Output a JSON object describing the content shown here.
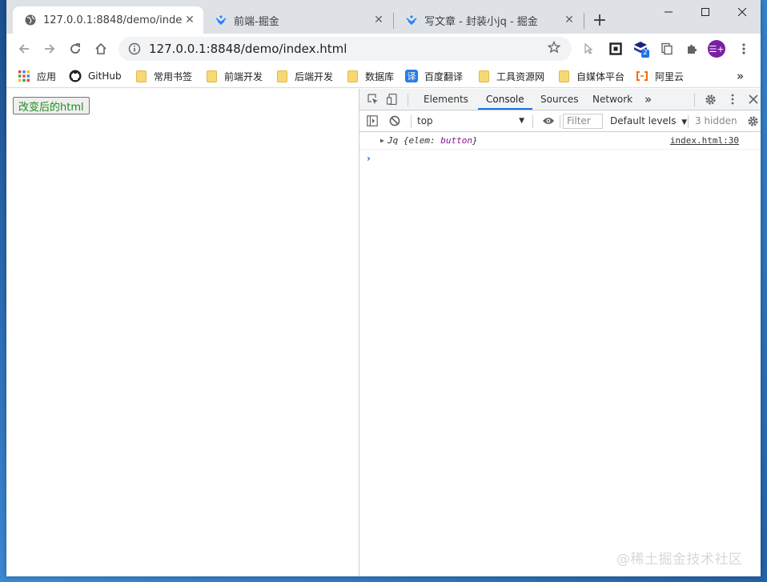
{
  "browser": {
    "tabs": [
      {
        "title": "127.0.0.1:8848/demo/index.html",
        "active": true,
        "favicon": "globe-icon"
      },
      {
        "title": "前端-掘金",
        "active": false,
        "favicon": "juejin-logo-icon"
      },
      {
        "title": "写文章 - 封装小jq - 掘金",
        "active": false,
        "favicon": "juejin-logo-icon"
      }
    ],
    "new_tab_label": "+",
    "address": "127.0.0.1:8848/demo/index.html",
    "extension_badge": "2",
    "bookmarks": [
      {
        "label": "应用",
        "icon": "apps-grid-icon"
      },
      {
        "label": "GitHub",
        "icon": "github-icon"
      },
      {
        "label": "常用书签",
        "icon": "folder-icon"
      },
      {
        "label": "前端开发",
        "icon": "folder-icon"
      },
      {
        "label": "后端开发",
        "icon": "folder-icon"
      },
      {
        "label": "数据库",
        "icon": "folder-icon"
      },
      {
        "label": "百度翻译",
        "icon": "baidu-translate-icon"
      },
      {
        "label": "工具资源网",
        "icon": "folder-icon"
      },
      {
        "label": "自媒体平台",
        "icon": "folder-icon"
      },
      {
        "label": "阿里云",
        "icon": "aliyun-icon"
      }
    ],
    "bookmarks_overflow": "»",
    "translate_glyph": "译",
    "profile_glyph": "☰+"
  },
  "page": {
    "button_label": "改变后的html"
  },
  "devtools": {
    "tabs": [
      "Elements",
      "Console",
      "Sources",
      "Network"
    ],
    "active_tab": "Console",
    "more_tabs": "»",
    "context": "top",
    "filter_placeholder": "Filter",
    "levels": "Default levels",
    "hidden": "3 hidden",
    "log": {
      "prefix": "Jq ",
      "open": "{",
      "key": "elem: ",
      "value": "button",
      "close": "}",
      "source": "index.html:30"
    },
    "prompt": "›"
  },
  "watermark": "@稀土掘金技术社区",
  "colors": {
    "accent": "#1a73e8",
    "page_button_text": "#1e8b1e",
    "devtools_value": "#881391",
    "profile": "#7b1fa2"
  }
}
